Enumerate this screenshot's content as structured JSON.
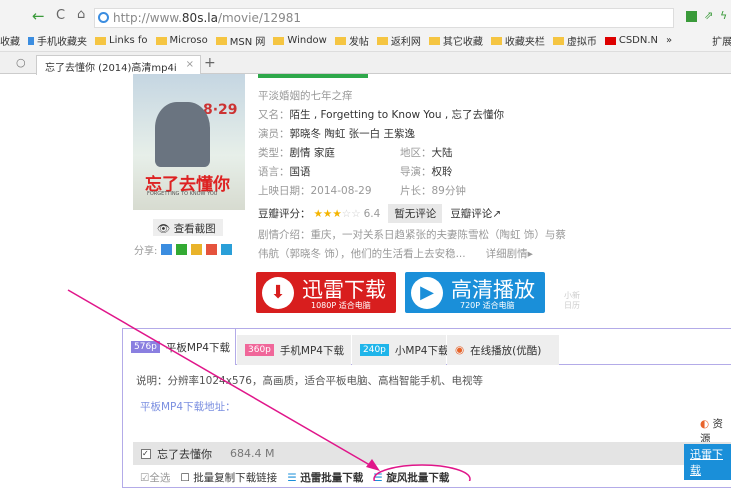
{
  "browser": {
    "url_prefix": "http://www.",
    "url_host": "80s.la",
    "url_path": "/movie/12981",
    "bookmarks": [
      "收藏",
      "手机收藏夹",
      "Links fo",
      "Microso",
      "MSN 网",
      "Window",
      "发帖",
      "返利网",
      "其它收藏",
      "收藏夹栏",
      "虚拟币",
      "CSDN.N",
      "»",
      "扩展"
    ],
    "tab_title": "忘了去懂你 (2014)高清mp4i",
    "tab_close": "×",
    "new_tab": "+"
  },
  "movie": {
    "tagline": "平淡婚姻的七年之痒",
    "alias_label": "又名：",
    "alias": "陌生 , Forgetting to Know You , 忘了去懂你",
    "cast_label": "演员：",
    "cast": "郭晓冬  陶虹  张一白  王紫逸",
    "genre_label": "类型：",
    "genre": "剧情 家庭",
    "region_label": "地区：",
    "region": "大陆",
    "lang_label": "语言：",
    "lang": "国语",
    "director_label": "导演：",
    "director": "权聆",
    "date_label": "上映日期：",
    "date": "2014-08-29",
    "length_label": "片长：",
    "length": "89分钟",
    "rating_label": "豆瓣评分：",
    "rating": "6.4",
    "rating_stars": 3,
    "no_review": "暂无评论",
    "douban_review": "豆瓣评论",
    "plot_label": "剧情介绍：",
    "plot1": "重庆，一对关系日趋紧张的夫妻陈雪松（陶虹 饰）与蔡",
    "plot2": "伟航（郭晓冬 饰），他们的生活看上去安稳...",
    "more": "详细剧情▸",
    "poster_title": "忘了去懂你",
    "poster_sub": "FORGETTING TO KNOW YOU",
    "poster_date": "8·29",
    "screenshots": "查看截图",
    "share": "分享:"
  },
  "buttons": {
    "thunder": "迅雷下载",
    "thunder_sub": "1080P 适合电脑",
    "play": "高清播放",
    "play_sub": "720P 适合电脑",
    "side": "小新\n日历"
  },
  "tabs": [
    {
      "badge": "576p",
      "label": "平板MP4下载",
      "color": "#8a7fe0"
    },
    {
      "badge": "360p",
      "label": "手机MP4下载",
      "color": "#f0679a"
    },
    {
      "badge": "240p",
      "label": "小MP4下载",
      "color": "#1fb5ea"
    },
    {
      "label": "在线播放(优酷)"
    }
  ],
  "desc": "说明：分辨率1024x576，高画质，适合平板电脑、高档智能手机、电视等",
  "addr_label": "平板MP4下载地址：",
  "resource": "资源",
  "file": {
    "name": "忘了去懂你",
    "size": "684.4 M",
    "action": "迅雷下载"
  },
  "batch": {
    "select_all": "全选",
    "copy": "批量复制下载链接",
    "thunder": "迅雷批量下载",
    "xf": "旋风批量下载"
  }
}
